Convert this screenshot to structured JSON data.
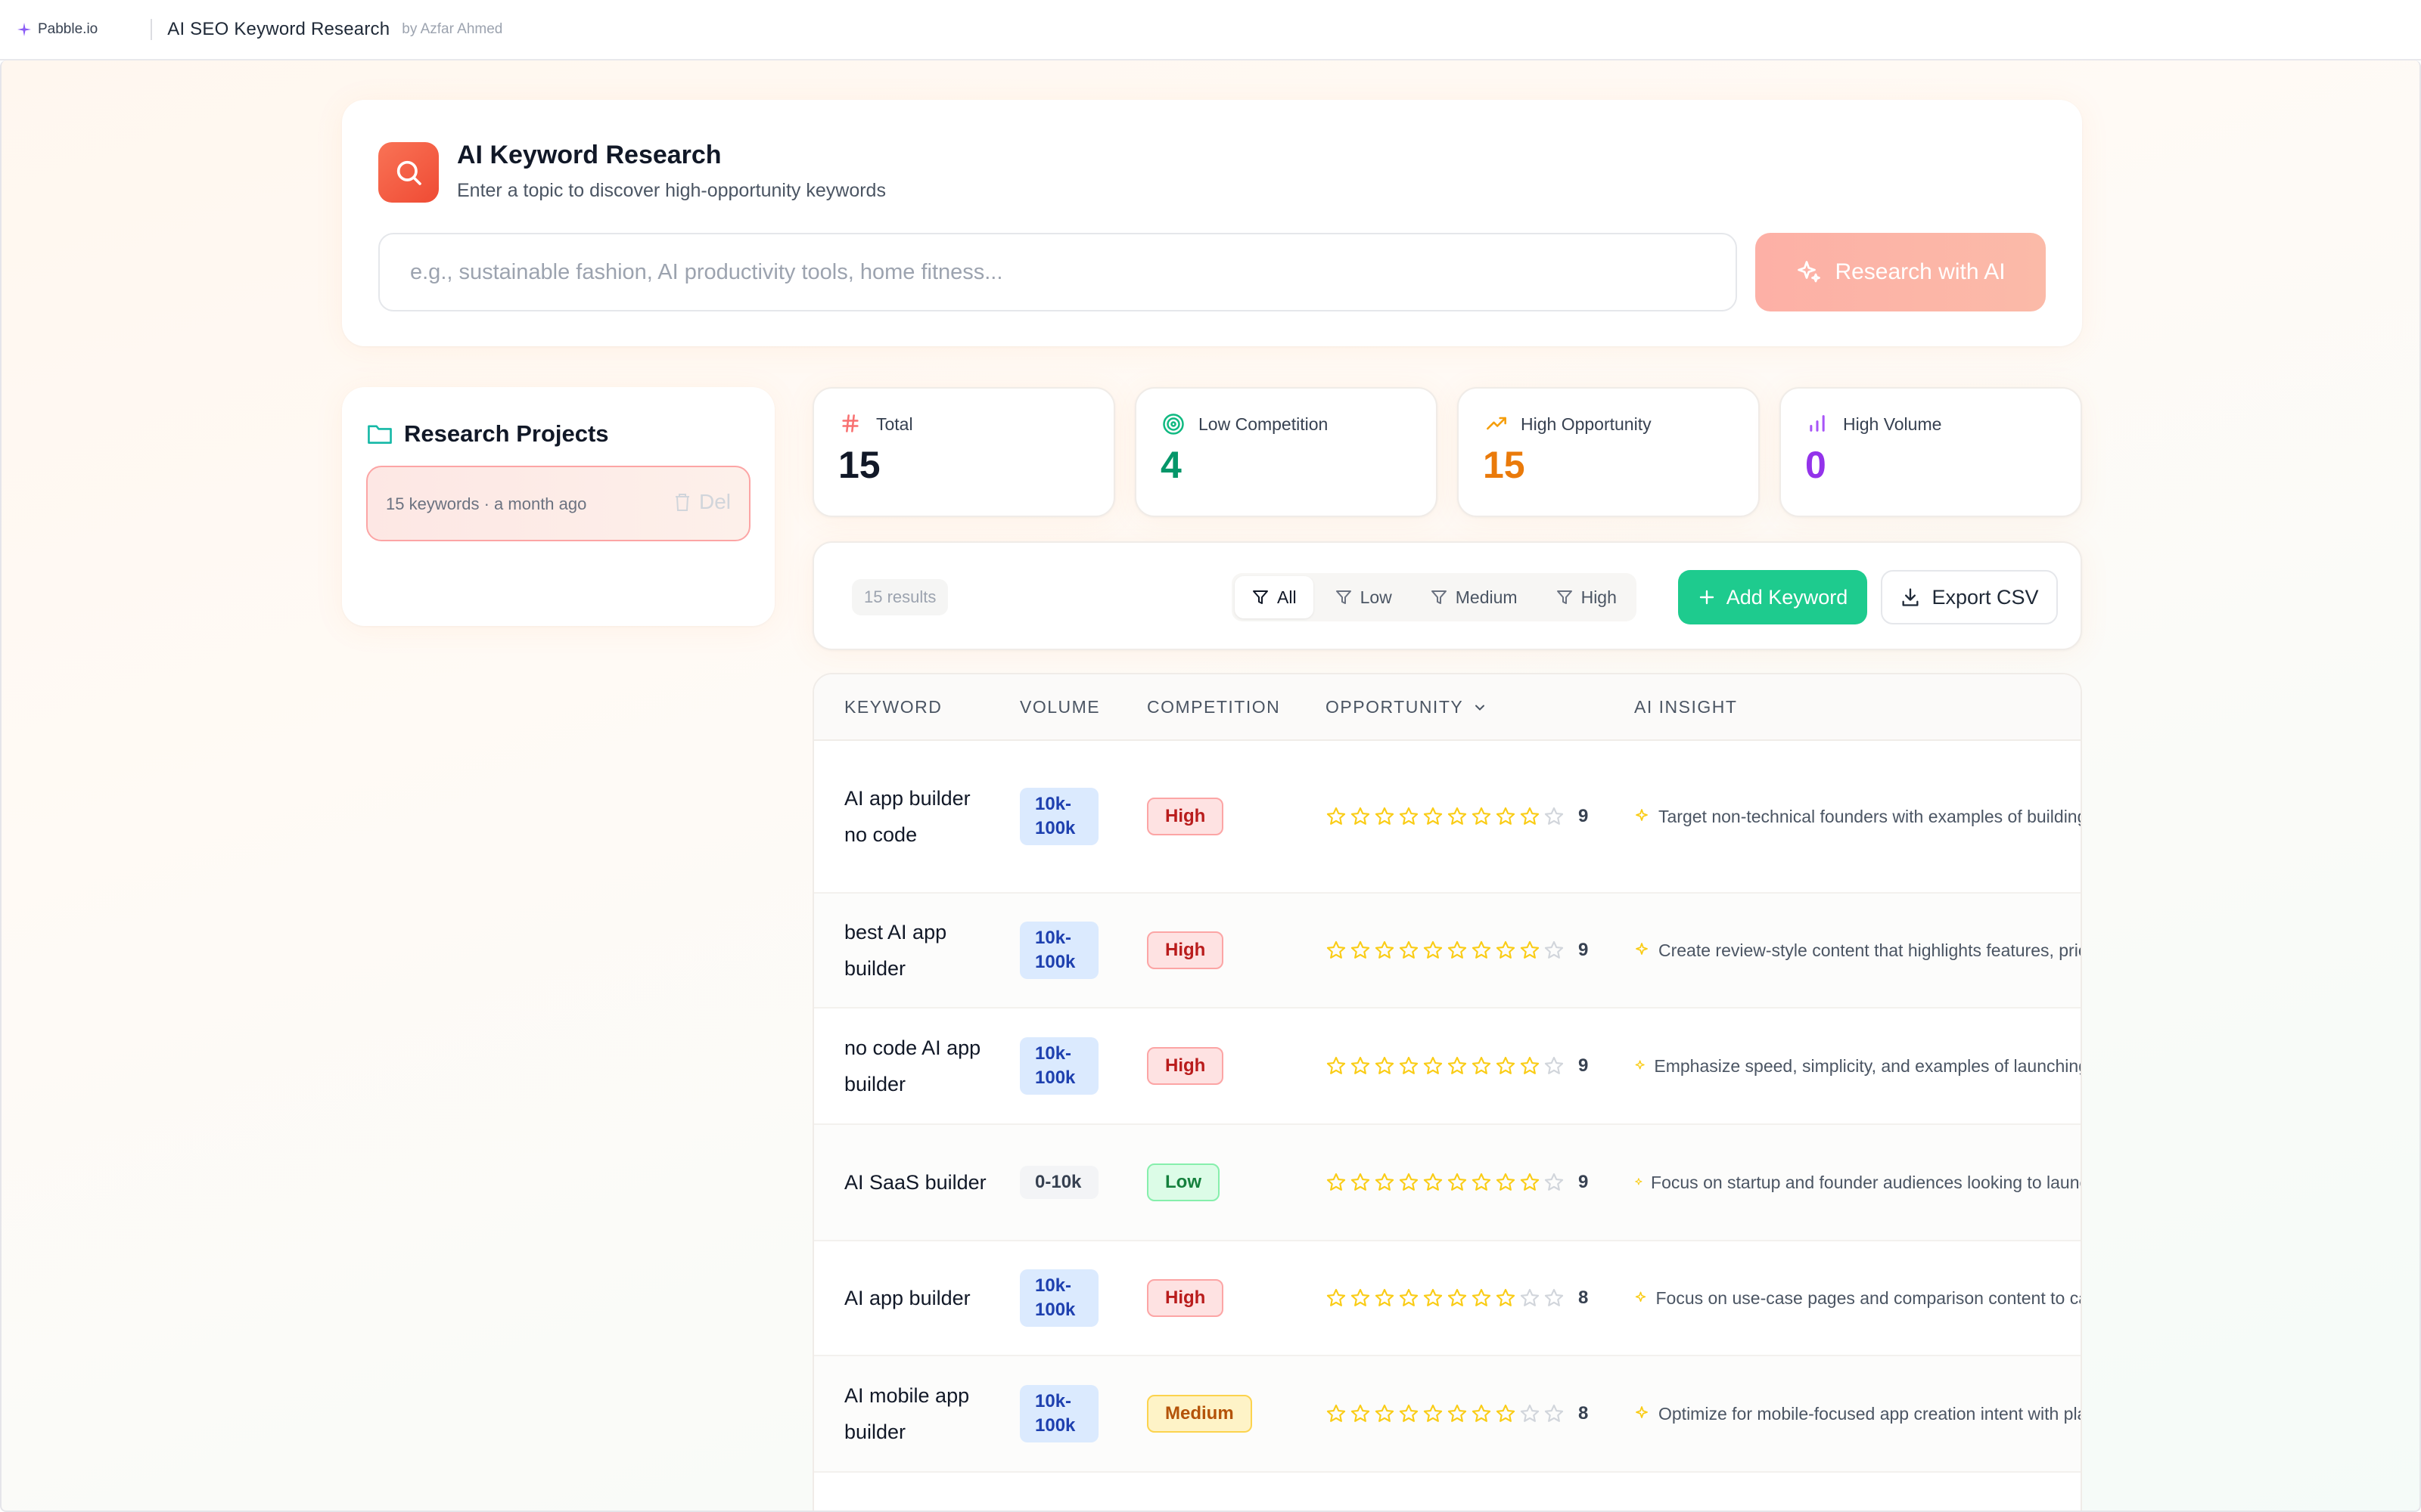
{
  "topbar": {
    "brand": "Pabble.io",
    "app_title": "AI SEO Keyword Research",
    "author": "by Azfar Ahmed"
  },
  "hero": {
    "title": "AI Keyword Research",
    "subtitle": "Enter a topic to discover high-opportunity keywords",
    "search_placeholder": "e.g., sustainable fashion, AI productivity tools, home fitness...",
    "search_value": "",
    "research_button": "Research with AI"
  },
  "projects": {
    "title": "Research Projects",
    "items": [
      {
        "meta": "15 keywords · a month ago",
        "delete_label": "Del"
      }
    ]
  },
  "stats": [
    {
      "label": "Total",
      "value": "15",
      "icon": "hash-icon",
      "color": "#111827",
      "icon_color": "#f87171"
    },
    {
      "label": "Low Competition",
      "value": "4",
      "icon": "target-icon",
      "color": "#059669",
      "icon_color": "#10b981"
    },
    {
      "label": "High Opportunity",
      "value": "15",
      "icon": "trending-up-icon",
      "color": "#ea7a0a",
      "icon_color": "#f59e0b"
    },
    {
      "label": "High Volume",
      "value": "0",
      "icon": "bar-chart-icon",
      "color": "#9333ea",
      "icon_color": "#a855f7"
    }
  ],
  "toolbar": {
    "results_count": "15 results",
    "filters": [
      "All",
      "Low",
      "Medium",
      "High"
    ],
    "active_filter": "All",
    "add_button": "Add Keyword",
    "export_button": "Export CSV"
  },
  "table": {
    "columns": [
      "KEYWORD",
      "VOLUME",
      "COMPETITION",
      "OPPORTUNITY",
      "AI INSIGHT"
    ],
    "rows": [
      {
        "keyword": "AI app builder no code",
        "volume": "10k-100k",
        "competition": "High",
        "opportunity": 9,
        "insight": "Target non-technical founders with examples of building"
      },
      {
        "keyword": "best AI app builder",
        "volume": "10k-100k",
        "competition": "High",
        "opportunity": 9,
        "insight": "Create review-style content that highlights features, pric"
      },
      {
        "keyword": "no code AI app builder",
        "volume": "10k-100k",
        "competition": "High",
        "opportunity": 9,
        "insight": "Emphasize speed, simplicity, and examples of launching"
      },
      {
        "keyword": "AI SaaS builder",
        "volume": "0-10k",
        "competition": "Low",
        "opportunity": 9,
        "insight": "Focus on startup and founder audiences looking to launc"
      },
      {
        "keyword": "AI app builder",
        "volume": "10k-100k",
        "competition": "High",
        "opportunity": 8,
        "insight": "Focus on use-case pages and comparison content to ca"
      },
      {
        "keyword": "AI mobile app builder",
        "volume": "10k-100k",
        "competition": "Medium",
        "opportunity": 8,
        "insight": "Optimize for mobile-focused app creation intent with pla"
      }
    ],
    "max_stars": 10
  },
  "colors": {
    "accent": "#ef5a3c",
    "green": "#1ecb8e",
    "star": "#facc15"
  }
}
